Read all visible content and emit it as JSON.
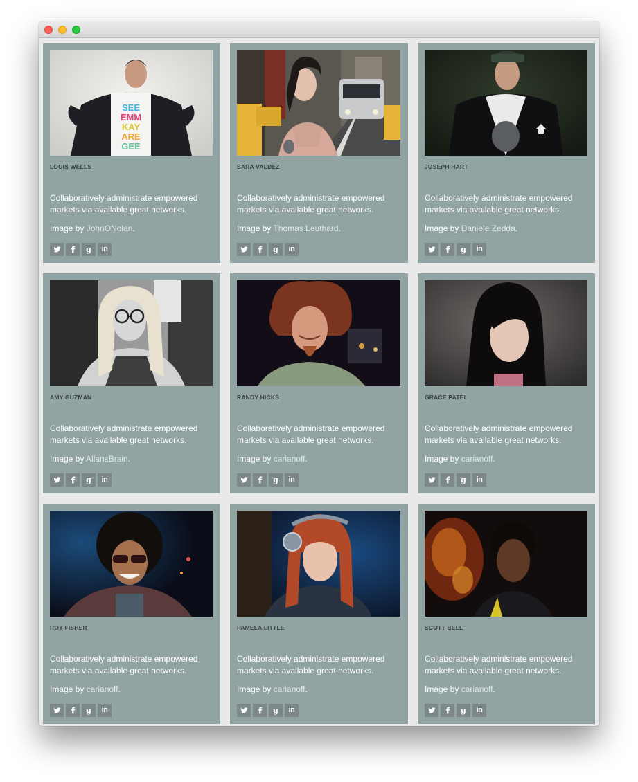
{
  "window": {
    "controls": [
      "close",
      "minimize",
      "zoom"
    ]
  },
  "colors": {
    "card_bg": "#92a3a4",
    "page_bg": "#e9e9e9",
    "social_bg": "#7d8889"
  },
  "cards": [
    {
      "name": "LOUIS WELLS",
      "description": "Collaboratively administrate empowered markets via available great networks.",
      "credit_prefix": "Image by",
      "author": "JohnONolan",
      "credit_suffix": "."
    },
    {
      "name": "SARA VALDEZ",
      "description": "Collaboratively administrate empowered markets via available great networks.",
      "credit_prefix": "Image by",
      "author": "Thomas Leuthard",
      "credit_suffix": "."
    },
    {
      "name": "JOSEPH HART",
      "description": "Collaboratively administrate empowered markets via available great networks.",
      "credit_prefix": "Image by",
      "author": "Daniele Zedda",
      "credit_suffix": "."
    },
    {
      "name": "AMY GUZMAN",
      "description": "Collaboratively administrate empowered markets via available great networks.",
      "credit_prefix": "Image by",
      "author": "AllansBrain",
      "credit_suffix": "."
    },
    {
      "name": "RANDY HICKS",
      "description": "Collaboratively administrate empowered markets via available great networks.",
      "credit_prefix": "Image by",
      "author": "carianoff",
      "credit_suffix": "."
    },
    {
      "name": "GRACE PATEL",
      "description": "Collaboratively administrate empowered markets via available great networks.",
      "credit_prefix": "Image by",
      "author": "carianoff",
      "credit_suffix": "."
    },
    {
      "name": "ROY FISHER",
      "description": "Collaboratively administrate empowered markets via available great networks.",
      "credit_prefix": "Image by",
      "author": "carianoff",
      "credit_suffix": "."
    },
    {
      "name": "PAMELA LITTLE",
      "description": "Collaboratively administrate empowered markets via available great networks.",
      "credit_prefix": "Image by",
      "author": "carianoff",
      "credit_suffix": "."
    },
    {
      "name": "SCOTT BELL",
      "description": "Collaboratively administrate empowered markets via available great networks.",
      "credit_prefix": "Image by",
      "author": "carianoff",
      "credit_suffix": "."
    }
  ],
  "social_icons": [
    "twitter-icon",
    "facebook-icon",
    "google-plus-icon",
    "linkedin-icon"
  ]
}
